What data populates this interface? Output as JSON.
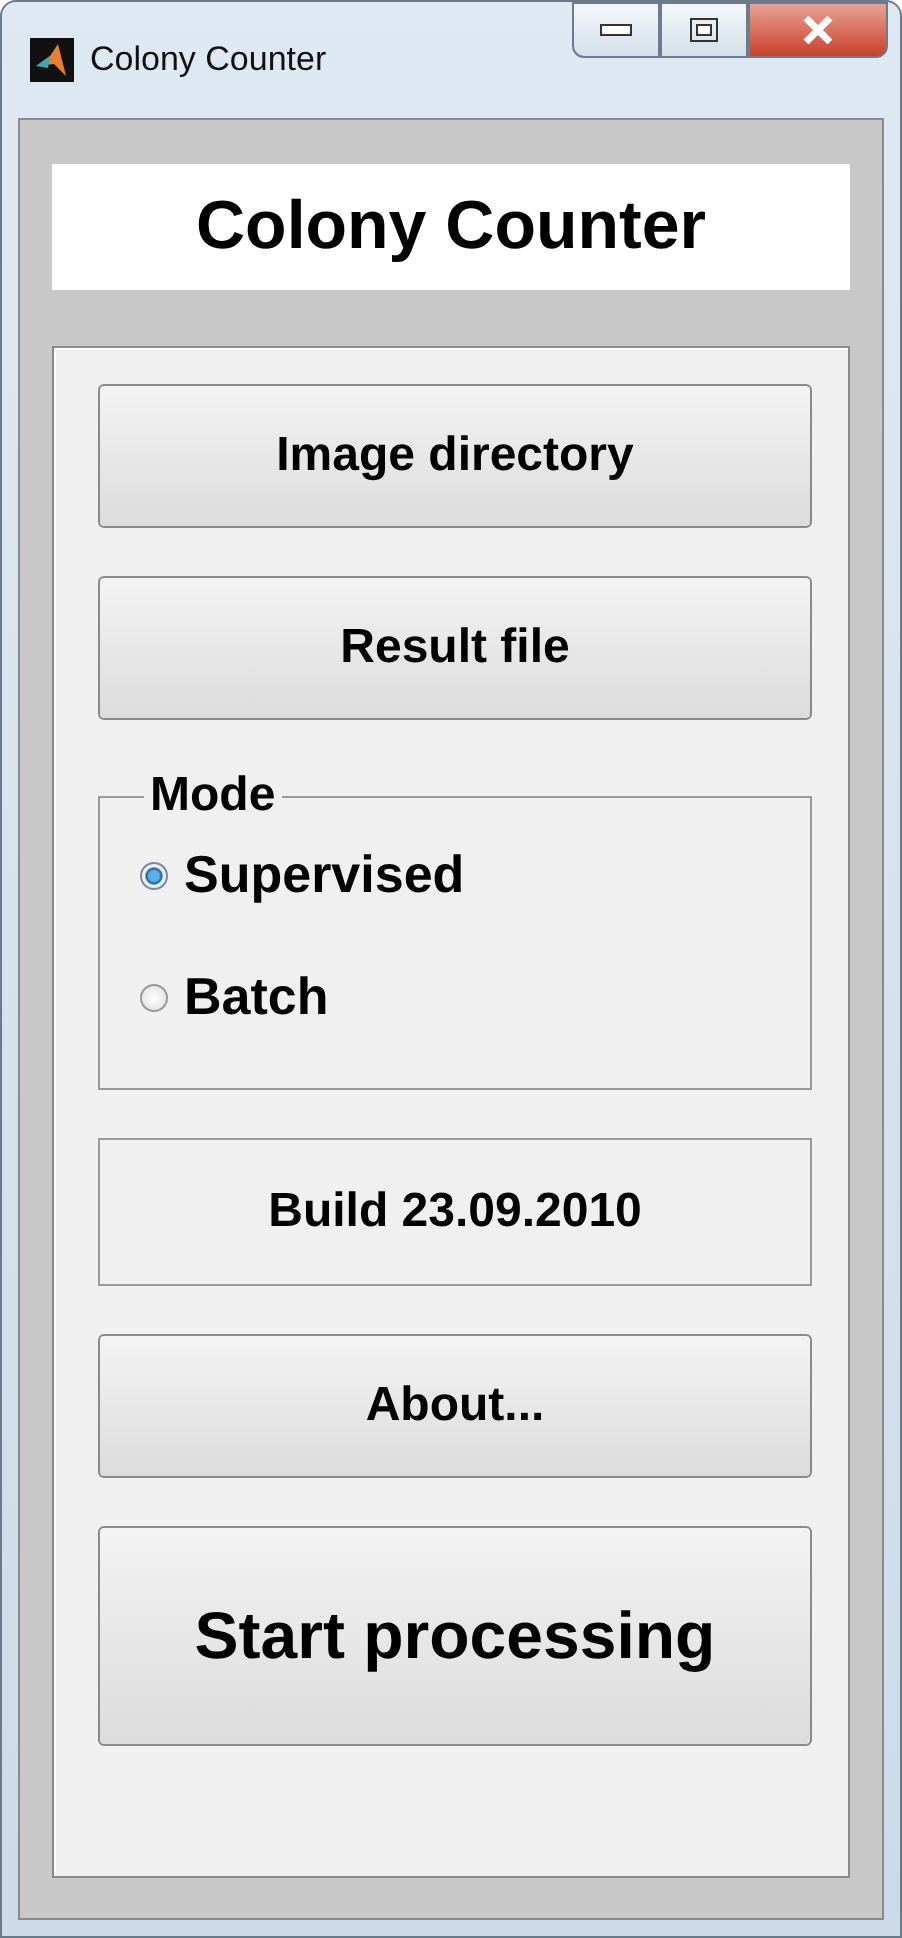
{
  "window": {
    "title": "Colony Counter"
  },
  "heading": "Colony Counter",
  "buttons_top": [
    {
      "label": "Image directory"
    },
    {
      "label": "Result file"
    }
  ],
  "mode": {
    "label": "Mode",
    "options": [
      {
        "label": "Supervised",
        "selected": true
      },
      {
        "label": "Batch",
        "selected": false
      }
    ]
  },
  "build": "Build 23.09.2010",
  "about_button": "About...",
  "start_button": "Start processing"
}
